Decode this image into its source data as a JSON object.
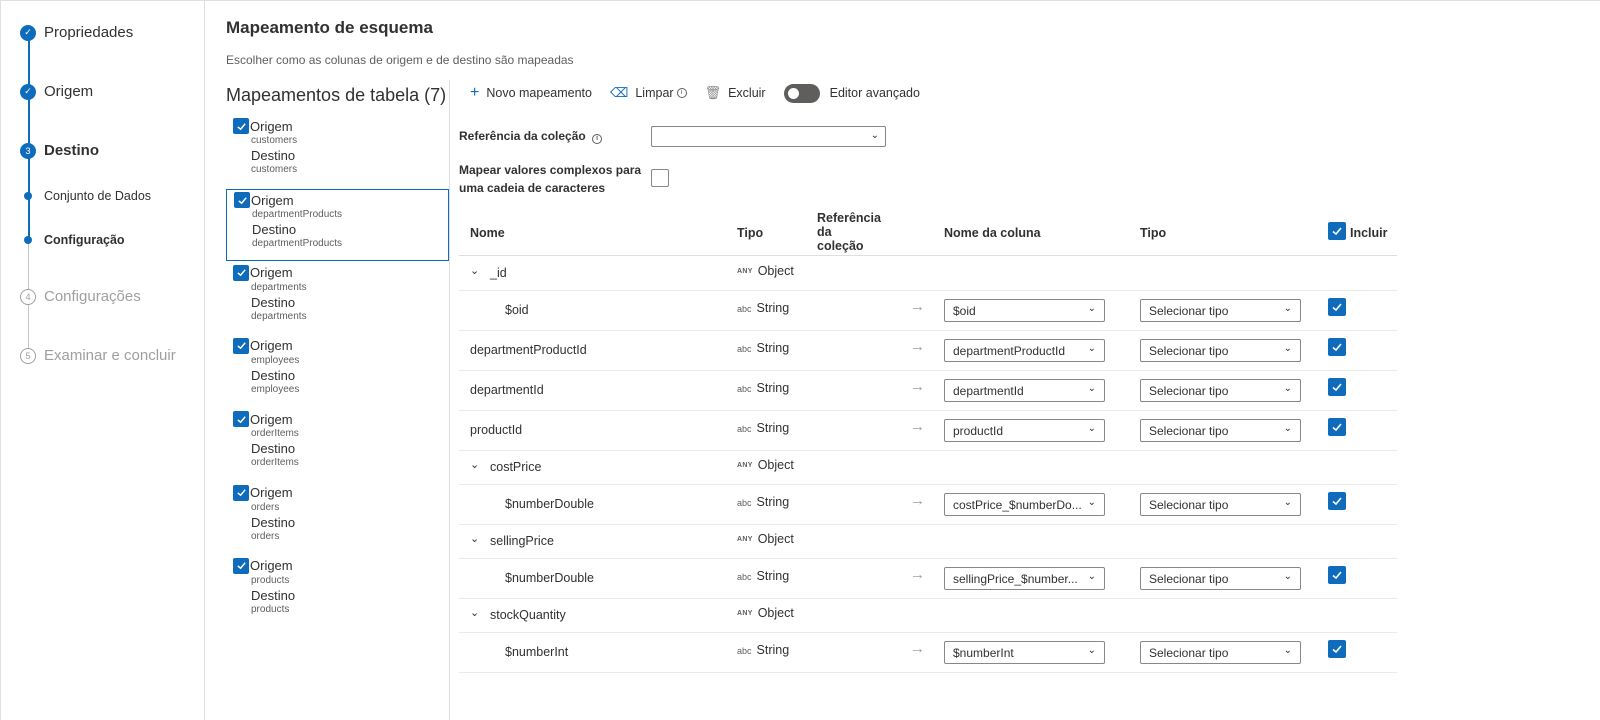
{
  "stepper": {
    "steps": [
      {
        "label": "Propriedades",
        "icon": "check-icon"
      },
      {
        "label": "Origem",
        "icon": "check-icon"
      },
      {
        "label": "Destino",
        "number": "3"
      },
      {
        "label": "Conjunto de Dados"
      },
      {
        "label": "Configuração"
      },
      {
        "label": "Configurações",
        "number": "4"
      },
      {
        "label": "Examinar e concluir",
        "number": "5"
      }
    ]
  },
  "header": {
    "title": "Mapeamento de esquema",
    "subtitle": "Escolher como as colunas de origem e de destino são mapeadas"
  },
  "table_mappings": {
    "title": "Mapeamentos de tabela (7)",
    "items": [
      {
        "source_label": "Origem",
        "source": "customers",
        "dest_label": "Destino",
        "dest": "customers"
      },
      {
        "source_label": "Origem",
        "source": "departmentProducts",
        "dest_label": "Destino",
        "dest": "departmentProducts"
      },
      {
        "source_label": "Origem",
        "source": "departments",
        "dest_label": "Destino",
        "dest": "departments"
      },
      {
        "source_label": "Origem",
        "source": "employees",
        "dest_label": "Destino",
        "dest": "employees"
      },
      {
        "source_label": "Origem",
        "source": "orderItems",
        "dest_label": "Destino",
        "dest": "orderItems"
      },
      {
        "source_label": "Origem",
        "source": "orders",
        "dest_label": "Destino",
        "dest": "orders"
      },
      {
        "source_label": "Origem",
        "source": "products",
        "dest_label": "Destino",
        "dest": "products"
      }
    ]
  },
  "toolbar": {
    "new_mapping": "Novo mapeamento",
    "clear": "Limpar",
    "delete": "Excluir",
    "advanced_editor": "Editor avançado",
    "advanced_editor_on": false
  },
  "form": {
    "collection_ref_label": "Referência da coleção",
    "collection_ref_value": "",
    "complex_label_line1": "Mapear valores complexos para",
    "complex_label_line2": "uma cadeia de caracteres",
    "complex_checked": false
  },
  "columns": {
    "name": "Nome",
    "type": "Tipo",
    "ref_line1": "Referência",
    "ref_line2": "da",
    "ref_line3": "coleção",
    "column_name": "Nome da coluna",
    "dest_type": "Tipo",
    "include": "Incluir"
  },
  "type_tags": {
    "any": "ANY",
    "abc": "abc"
  },
  "rows": [
    {
      "name": "_id",
      "type": "Object",
      "group": true
    },
    {
      "name": "$oid",
      "type": "String",
      "column": "$oid",
      "dest_type": "Selecionar tipo",
      "child": true
    },
    {
      "name": "departmentProductId",
      "type": "String",
      "column": "departmentProductId",
      "dest_type": "Selecionar tipo"
    },
    {
      "name": "departmentId",
      "type": "String",
      "column": "departmentId",
      "dest_type": "Selecionar tipo"
    },
    {
      "name": "productId",
      "type": "String",
      "column": "productId",
      "dest_type": "Selecionar tipo"
    },
    {
      "name": "costPrice",
      "type": "Object",
      "group": true
    },
    {
      "name": "$numberDouble",
      "type": "String",
      "column": "costPrice_$numberDo...",
      "dest_type": "Selecionar tipo",
      "child": true
    },
    {
      "name": "sellingPrice",
      "type": "Object",
      "group": true
    },
    {
      "name": "$numberDouble",
      "type": "String",
      "column": "sellingPrice_$number...",
      "dest_type": "Selecionar tipo",
      "child": true
    },
    {
      "name": "stockQuantity",
      "type": "Object",
      "group": true
    },
    {
      "name": "$numberInt",
      "type": "String",
      "column": "$numberInt",
      "dest_type": "Selecionar tipo",
      "child": true
    }
  ],
  "colors": {
    "accent": "#0f6cbd"
  }
}
